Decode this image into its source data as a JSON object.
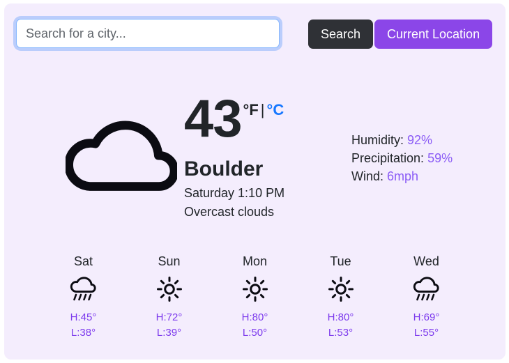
{
  "search": {
    "placeholder": "Search for a city...",
    "value": "",
    "search_label": "Search",
    "location_label": "Current Location"
  },
  "current": {
    "icon": "cloud-icon",
    "temperature": "43",
    "unit_fahrenheit": "°F",
    "unit_separator": "|",
    "unit_celsius": "°C",
    "city": "Boulder",
    "local_time": "Saturday 1:10 PM",
    "conditions": "Overcast clouds",
    "details": [
      {
        "label": "Humidity:",
        "value": "92%"
      },
      {
        "label": "Precipitation:",
        "value": "59%"
      },
      {
        "label": "Wind:",
        "value": "6mph"
      }
    ]
  },
  "forecast": [
    {
      "day": "Sat",
      "icon": "cloud-rain-icon",
      "high": "H:45°",
      "low": "L:38°"
    },
    {
      "day": "Sun",
      "icon": "sun-icon",
      "high": "H:72°",
      "low": "L:39°"
    },
    {
      "day": "Mon",
      "icon": "sun-icon",
      "high": "H:80°",
      "low": "L:50°"
    },
    {
      "day": "Tue",
      "icon": "sun-icon",
      "high": "H:80°",
      "low": "L:53°"
    },
    {
      "day": "Wed",
      "icon": "cloud-rain-icon",
      "high": "H:69°",
      "low": "L:55°"
    }
  ],
  "colors": {
    "card_background": "#f4edfd",
    "accent_purple": "#8b46e8",
    "value_purple": "#8b5cf6",
    "forecast_purple": "#7c3aed",
    "search_button": "#2f3136",
    "link_blue": "#1677ff",
    "text": "#212529"
  }
}
